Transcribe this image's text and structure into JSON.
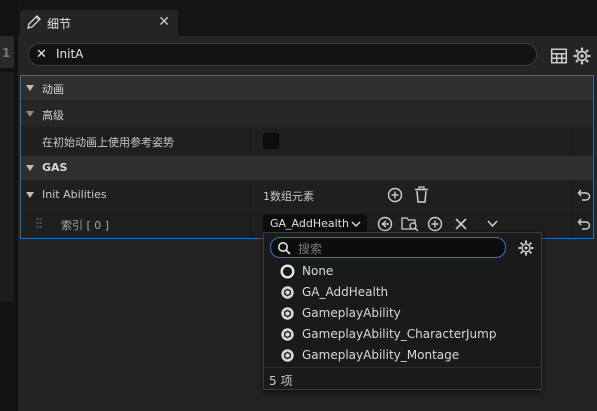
{
  "window": {
    "tab_title": "细节",
    "tab_close": "✕",
    "left_marker": "1"
  },
  "search": {
    "value": "InitA",
    "clear": "✕"
  },
  "categories": {
    "animation": "动画",
    "advanced": "高级",
    "gas": "GAS"
  },
  "properties": {
    "ref_pose_label": "在初始动画上使用参考姿势",
    "init_abilities_label": "Init Abilities",
    "array_count": "1数组元素",
    "index_label": "索引 [ 0 ]",
    "selected_value": "GA_AddHealth"
  },
  "picker": {
    "search_placeholder": "搜索",
    "items": [
      {
        "label": "None",
        "icon": "none-circle-icon"
      },
      {
        "label": "GA_AddHealth",
        "icon": "blueprint-class-icon"
      },
      {
        "label": "GameplayAbility",
        "icon": "blueprint-class-icon"
      },
      {
        "label": "GameplayAbility_CharacterJump",
        "icon": "blueprint-class-icon"
      },
      {
        "label": "GameplayAbility_Montage",
        "icon": "blueprint-class-icon"
      }
    ],
    "count": "5 项"
  },
  "colors": {
    "accent_blue": "#2f6db3",
    "panel": "#242424",
    "category": "#2f2f2f"
  }
}
